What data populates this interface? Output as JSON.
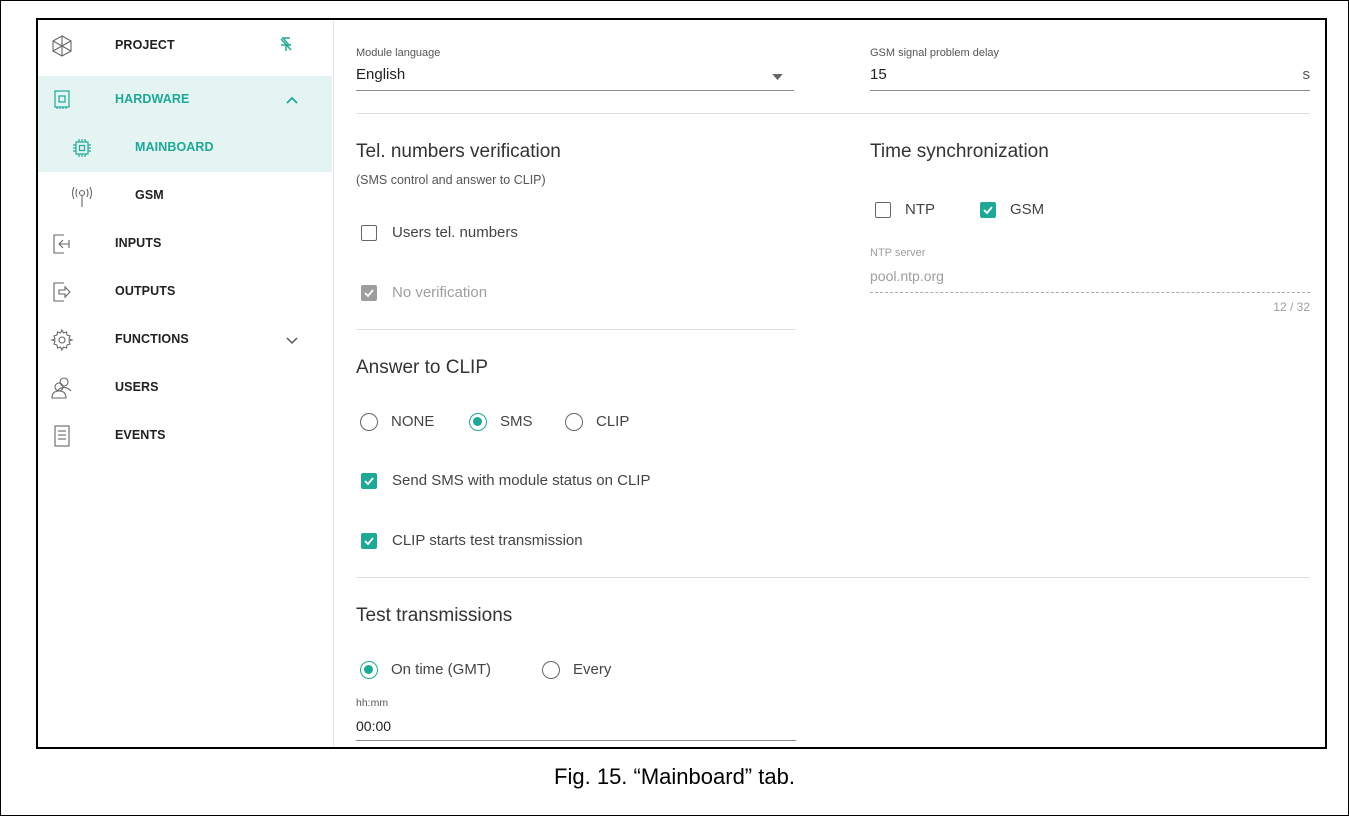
{
  "sidebar": {
    "items": [
      {
        "label": "PROJECT",
        "icon": "project-icon"
      },
      {
        "label": "HARDWARE",
        "icon": "hardware-chip-icon"
      },
      {
        "label": "MAINBOARD",
        "icon": "mainboard-icon"
      },
      {
        "label": "GSM",
        "icon": "gsm-antenna-icon"
      },
      {
        "label": "INPUTS",
        "icon": "inputs-icon"
      },
      {
        "label": "OUTPUTS",
        "icon": "outputs-icon"
      },
      {
        "label": "FUNCTIONS",
        "icon": "functions-gear-icon"
      },
      {
        "label": "USERS",
        "icon": "users-icon"
      },
      {
        "label": "EVENTS",
        "icon": "events-document-icon"
      }
    ]
  },
  "main": {
    "module_language": {
      "label": "Module language",
      "value": "English"
    },
    "gsm_delay": {
      "label": "GSM signal problem delay",
      "value": "15",
      "unit": "s"
    },
    "tel_verification": {
      "title": "Tel. numbers verification",
      "note": "(SMS control and answer to CLIP)",
      "users_tel_numbers": {
        "label": "Users tel. numbers",
        "checked": false
      },
      "no_verification": {
        "label": "No verification",
        "checked": true,
        "disabled": true
      }
    },
    "time_sync": {
      "title": "Time synchronization",
      "ntp": {
        "label": "NTP",
        "checked": false
      },
      "gsm": {
        "label": "GSM",
        "checked": true
      },
      "ntp_server": {
        "label": "NTP server",
        "value": "pool.ntp.org",
        "counter": "12 / 32"
      }
    },
    "answer_clip": {
      "title": "Answer to CLIP",
      "options": [
        "NONE",
        "SMS",
        "CLIP"
      ],
      "selected": "SMS",
      "send_sms": {
        "label": "Send SMS with module status on CLIP",
        "checked": true
      },
      "clip_test": {
        "label": "CLIP starts test transmission",
        "checked": true
      }
    },
    "test_transmissions": {
      "title": "Test transmissions",
      "options": [
        "On time (GMT)",
        "Every"
      ],
      "selected": "On time (GMT)",
      "time": {
        "label": "hh:mm",
        "value": "00:00"
      }
    }
  },
  "caption": "Fig. 15. “Mainboard” tab.",
  "colors": {
    "accent": "#1ea896",
    "active_bg": "#e3f4f2"
  }
}
